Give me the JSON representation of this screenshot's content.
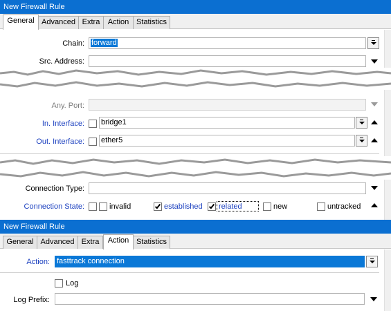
{
  "window1": {
    "title": "New Firewall Rule",
    "tabs": [
      "General",
      "Advanced",
      "Extra",
      "Action",
      "Statistics"
    ],
    "active_tab": "General",
    "chain": {
      "label": "Chain:",
      "value": "forward"
    },
    "src_address": {
      "label": "Src. Address:",
      "value": ""
    },
    "any_port": {
      "label": "Any. Port:",
      "value": ""
    },
    "in_interface": {
      "label": "In. Interface:",
      "value": "bridge1",
      "negate": false
    },
    "out_interface": {
      "label": "Out. Interface:",
      "value": "ether5",
      "negate": false
    },
    "connection_type": {
      "label": "Connection Type:",
      "value": ""
    },
    "connection_state": {
      "label": "Connection State:",
      "negate": false,
      "options": [
        {
          "label": "invalid",
          "checked": false
        },
        {
          "label": "established",
          "checked": true
        },
        {
          "label": "related",
          "checked": true
        },
        {
          "label": "new",
          "checked": false
        },
        {
          "label": "untracked",
          "checked": false
        }
      ]
    }
  },
  "window2": {
    "title": "New Firewall Rule",
    "tabs": [
      "General",
      "Advanced",
      "Extra",
      "Action",
      "Statistics"
    ],
    "active_tab": "Action",
    "action": {
      "label": "Action:",
      "value": "fasttrack connection"
    },
    "log": {
      "label": "Log",
      "checked": false
    },
    "log_prefix": {
      "label": "Log Prefix:",
      "value": ""
    }
  },
  "colors": {
    "titlebar": "#0b6fd1",
    "link_label": "#1a3fbf",
    "selection": "#0a78d7"
  },
  "icons": [
    "dropdown-icon",
    "arrow-down-icon",
    "arrow-up-icon",
    "checkbox-icon"
  ]
}
